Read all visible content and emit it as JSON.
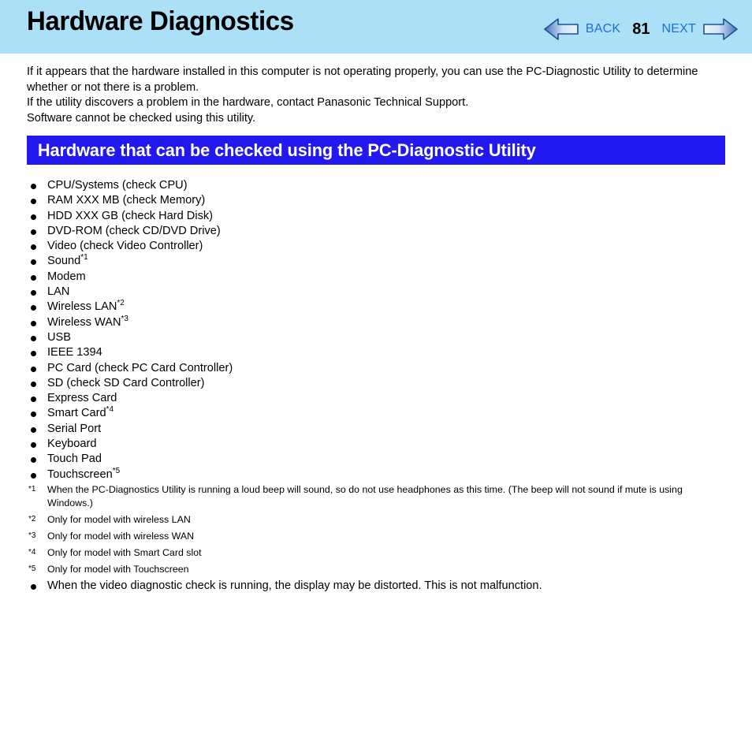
{
  "header": {
    "title": "Hardware Diagnostics",
    "nav": {
      "back_label": "BACK",
      "page_number": "81",
      "next_label": "NEXT",
      "back_arrow_icon": "arrow-left-icon",
      "next_arrow_icon": "arrow-right-icon"
    },
    "band_color": "#ace0f7",
    "link_color": "#1f6fd0"
  },
  "intro": {
    "line1": "If it appears that the hardware installed in this computer is not operating properly, you can use the PC-Diagnostic Utility to determine whether or not there is a problem.",
    "line2": "If the utility discovers a problem in the hardware, contact Panasonic Technical Support.",
    "line3": "Software cannot be checked using this utility."
  },
  "section": {
    "title": "Hardware that can be checked using the PC-Diagnostic Utility",
    "bar_color": "#2218f0",
    "text_color": "#ffffff"
  },
  "hardware_items": [
    {
      "label": "CPU/Systems (check CPU)",
      "mark": ""
    },
    {
      "label": "RAM XXX MB (check Memory)",
      "mark": ""
    },
    {
      "label": "HDD XXX GB (check Hard Disk)",
      "mark": ""
    },
    {
      "label": "DVD-ROM (check CD/DVD Drive)",
      "mark": ""
    },
    {
      "label": "Video (check Video Controller)",
      "mark": ""
    },
    {
      "label": "Sound",
      "mark": "*1"
    },
    {
      "label": "Modem",
      "mark": ""
    },
    {
      "label": "LAN",
      "mark": ""
    },
    {
      "label": "Wireless LAN",
      "mark": "*2"
    },
    {
      "label": "Wireless WAN",
      "mark": "*3"
    },
    {
      "label": "USB",
      "mark": ""
    },
    {
      "label": "IEEE 1394",
      "mark": ""
    },
    {
      "label": "PC Card (check PC Card Controller)",
      "mark": ""
    },
    {
      "label": "SD (check SD Card Controller)",
      "mark": ""
    },
    {
      "label": "Express Card",
      "mark": ""
    },
    {
      "label": "Smart Card",
      "mark": "*4"
    },
    {
      "label": "Serial Port",
      "mark": ""
    },
    {
      "label": "Keyboard",
      "mark": ""
    },
    {
      "label": "Touch Pad",
      "mark": ""
    },
    {
      "label": "Touchscreen",
      "mark": "*5"
    }
  ],
  "footnotes": [
    {
      "mark": "*1",
      "text": "When the PC-Diagnostics Utility is running a loud beep will sound, so do not use headphones as this time. (The beep will not sound if mute is using Windows.)"
    },
    {
      "mark": "*2",
      "text": "Only for model with wireless LAN"
    },
    {
      "mark": "*3",
      "text": "Only for model with wireless WAN"
    },
    {
      "mark": "*4",
      "text": "Only for model with Smart Card slot"
    },
    {
      "mark": "*5",
      "text": "Only for model with Touchscreen"
    }
  ],
  "final_note": "When the video diagnostic check is running, the display may be distorted. This is not malfunction."
}
